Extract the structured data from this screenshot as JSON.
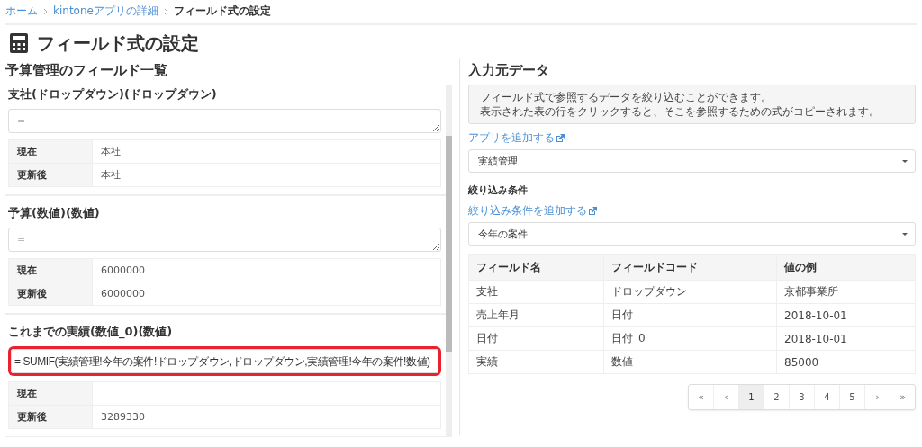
{
  "breadcrumb": [
    {
      "label": "ホーム",
      "link": true
    },
    {
      "label": "kintoneアプリの詳細",
      "link": true
    },
    {
      "label": "フィールド式の設定",
      "link": false
    }
  ],
  "title": "フィールド式の設定",
  "left_panel": {
    "heading": "予算管理のフィールド一覧",
    "fields": [
      {
        "heading": "支社(ドロップダウン)(ドロップダウン)",
        "formula": {
          "placeholder": "=",
          "highlighted": false
        },
        "rows": [
          {
            "label": "現在",
            "value": "本社"
          },
          {
            "label": "更新後",
            "value": "本社"
          }
        ]
      },
      {
        "heading": "予算(数値)(数値)",
        "formula": {
          "placeholder": "=",
          "highlighted": false
        },
        "rows": [
          {
            "label": "現在",
            "value": "6000000"
          },
          {
            "label": "更新後",
            "value": "6000000"
          }
        ]
      },
      {
        "heading": "これまでの実績(数値_0)(数値)",
        "formula": {
          "value": "= SUMIF(実績管理!今年の案件!ドロップダウン,ドロップダウン,実績管理!今年の案件!数値)",
          "highlighted": true
        },
        "rows": [
          {
            "label": "現在"
          },
          {
            "label": "更新後",
            "value": "3289330"
          }
        ]
      }
    ]
  },
  "right_panel": {
    "heading": "入力元データ",
    "info": [
      "フィールド式で参照するデータを絞り込むことができます。",
      "表示された表の行をクリックすると、そこを参照するための式がコピーされます。"
    ],
    "add_app_link": "アプリを追加する",
    "app_select": "実績管理",
    "filter_label": "絞り込み条件",
    "add_filter_link": "絞り込み条件を追加する",
    "filter_select": "今年の案件",
    "table": {
      "columns": [
        "フィールド名",
        "フィールドコード",
        "値の例"
      ],
      "rows": [
        [
          "支社",
          "ドロップダウン",
          "京都事業所"
        ],
        [
          "売上年月",
          "日付",
          "2018-10-01"
        ],
        [
          "日付",
          "日付_0",
          "2018-10-01"
        ],
        [
          "実績",
          "数値",
          "85000"
        ]
      ]
    },
    "pagination": [
      {
        "label": "«",
        "selected": false
      },
      {
        "label": "‹",
        "selected": false
      },
      {
        "label": "1",
        "selected": true
      },
      {
        "label": "2",
        "selected": false
      },
      {
        "label": "3",
        "selected": false
      },
      {
        "label": "4",
        "selected": false
      },
      {
        "label": "5",
        "selected": false
      },
      {
        "label": "›",
        "selected": false
      },
      {
        "label": "»",
        "selected": false
      }
    ]
  }
}
